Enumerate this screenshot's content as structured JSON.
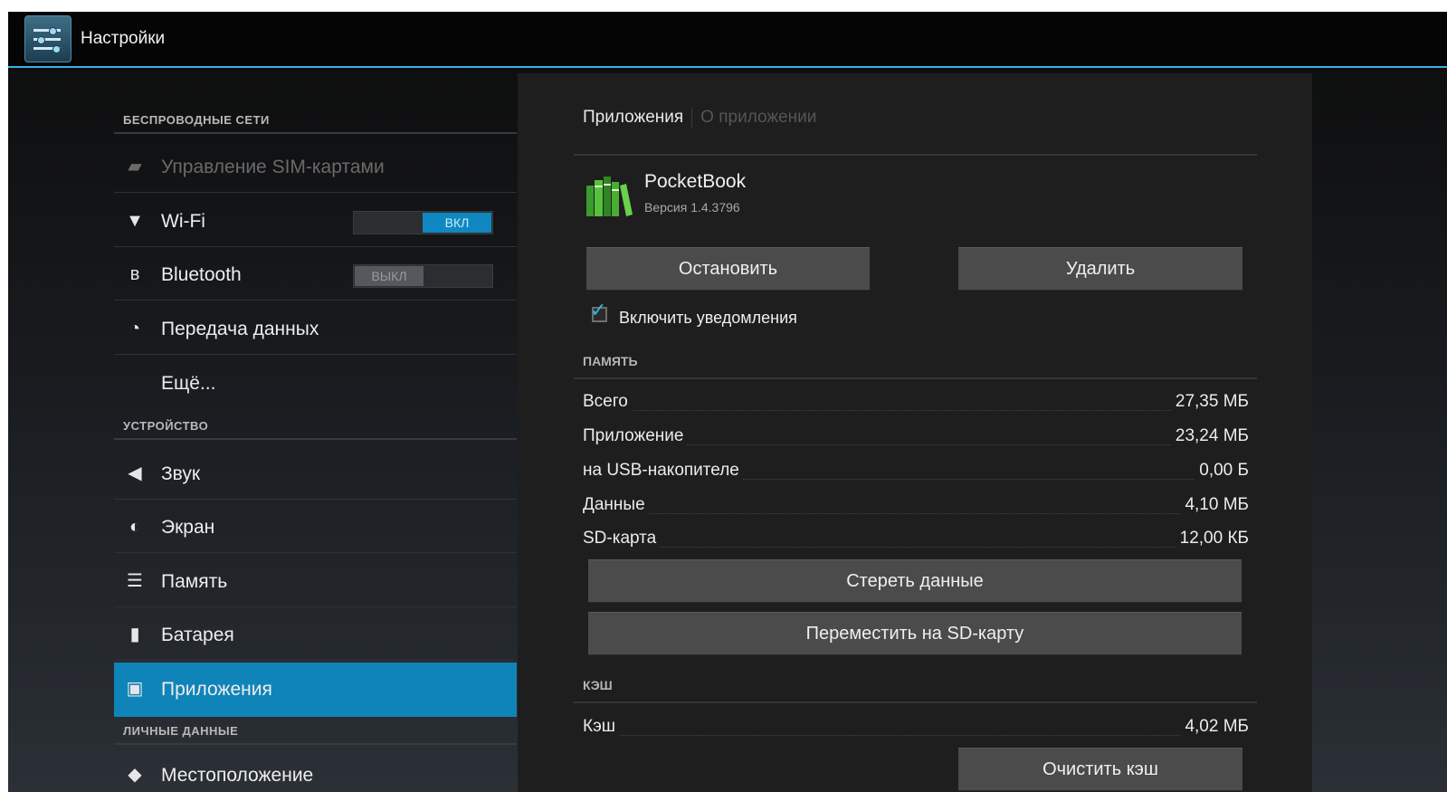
{
  "header": {
    "title": "Настройки",
    "icon": "settings-sliders-icon"
  },
  "sidebar": {
    "sections": [
      {
        "title": "БЕСПРОВОДНЫЕ СЕТИ"
      },
      {
        "title": "УСТРОЙСТВО"
      },
      {
        "title": "ЛИЧНЫЕ ДАННЫЕ"
      }
    ],
    "items": [
      {
        "label": "Управление SIM-картами",
        "icon": "sim-card-icon",
        "disabled": true
      },
      {
        "label": "Wi-Fi",
        "icon": "wifi-icon",
        "toggle": "ВКЛ"
      },
      {
        "label": "Bluetooth",
        "icon": "bluetooth-icon",
        "toggle": "ВЫКЛ"
      },
      {
        "label": "Передача данных",
        "icon": "data-usage-icon"
      },
      {
        "label": "Ещё..."
      },
      {
        "label": "Звук",
        "icon": "sound-icon"
      },
      {
        "label": "Экран",
        "icon": "display-icon"
      },
      {
        "label": "Память",
        "icon": "storage-icon"
      },
      {
        "label": "Батарея",
        "icon": "battery-icon"
      },
      {
        "label": "Приложения",
        "icon": "apps-icon",
        "selected": true
      },
      {
        "label": "Местоположение",
        "icon": "location-icon"
      }
    ],
    "accent": "#0f84b8"
  },
  "detail": {
    "tabs": [
      "Приложения",
      "О приложении"
    ],
    "app": {
      "name": "PocketBook",
      "version": "Версия 1.4.3796",
      "icon": "pocketbook-books-icon"
    },
    "buttons": {
      "stop": "Остановить",
      "uninstall": "Удалить"
    },
    "notifications": {
      "label": "Включить уведомления",
      "checked": true
    },
    "storage": {
      "title": "ПАМЯТЬ",
      "rows": [
        {
          "key": "Всего",
          "value": "27,35 МБ"
        },
        {
          "key": "Приложение",
          "value": "23,24 МБ"
        },
        {
          "key": "на USB-накопителе",
          "value": "0,00 Б"
        },
        {
          "key": "Данные",
          "value": "4,10 МБ"
        },
        {
          "key": "SD-карта",
          "value": "12,00 КБ"
        }
      ],
      "clear_data": "Стереть данные",
      "move_sd": "Переместить на SD-карту"
    },
    "cache": {
      "title": "КЭШ",
      "key": "Кэш",
      "value": "4,02 МБ",
      "clear": "Очистить кэш"
    }
  },
  "colors": {
    "accent": "#33b5e5",
    "toggle_on": "#0f88c2"
  }
}
